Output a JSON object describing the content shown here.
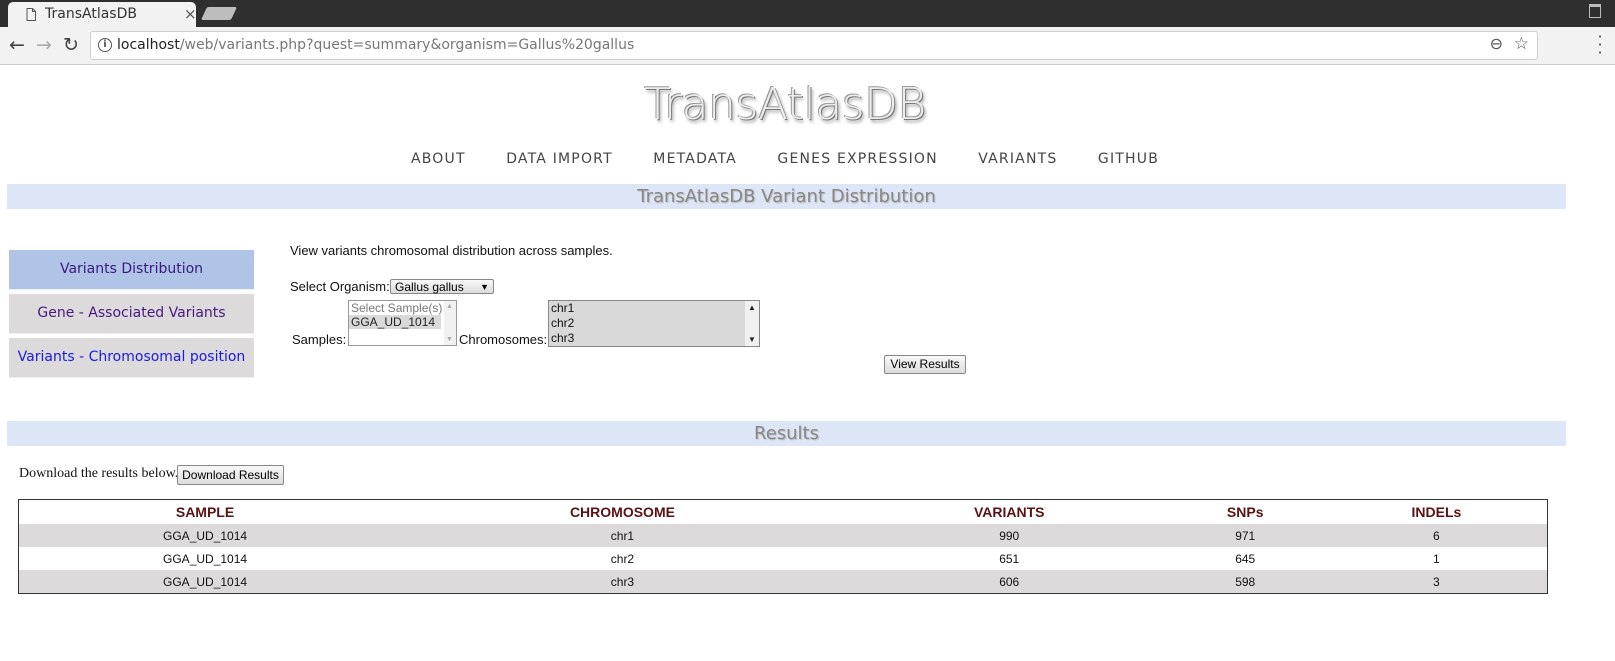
{
  "browser": {
    "tab_title": "TransAtlasDB",
    "tab_close": "×",
    "url_host": "localhost",
    "url_path": "/web/variants.php?quest=summary&organism=Gallus%20gallus"
  },
  "site": {
    "title": "TransAtlasDB",
    "nav": [
      "ABOUT",
      "DATA IMPORT",
      "METADATA",
      "GENES EXPRESSION",
      "VARIANTS",
      "GITHUB"
    ]
  },
  "section_title": "TransAtlasDB Variant Distribution",
  "sidebar": {
    "items": [
      "Variants Distribution",
      "Gene - Associated Variants",
      "Variants - Chromosomal position"
    ]
  },
  "form": {
    "intro": "View variants chromosomal distribution across samples.",
    "organism_label": "Select Organism:",
    "organism_value": "Gallus gallus",
    "samples_label": "Samples:",
    "samples_options": [
      "Select Sample(s)",
      "GGA_UD_1014"
    ],
    "chromosomes_label": "Chromosomes:",
    "chromosome_options": [
      "chr1",
      "chr2",
      "chr3"
    ],
    "view_results_label": "View Results"
  },
  "results": {
    "title": "Results",
    "download_text": "Download the results below.",
    "download_button": "Download Results",
    "columns": [
      "SAMPLE",
      "CHROMOSOME",
      "VARIANTS",
      "SNPs",
      "INDELs"
    ],
    "rows": [
      [
        "GGA_UD_1014",
        "chr1",
        "990",
        "971",
        "6"
      ],
      [
        "GGA_UD_1014",
        "chr2",
        "651",
        "645",
        "1"
      ],
      [
        "GGA_UD_1014",
        "chr3",
        "606",
        "598",
        "3"
      ]
    ]
  }
}
